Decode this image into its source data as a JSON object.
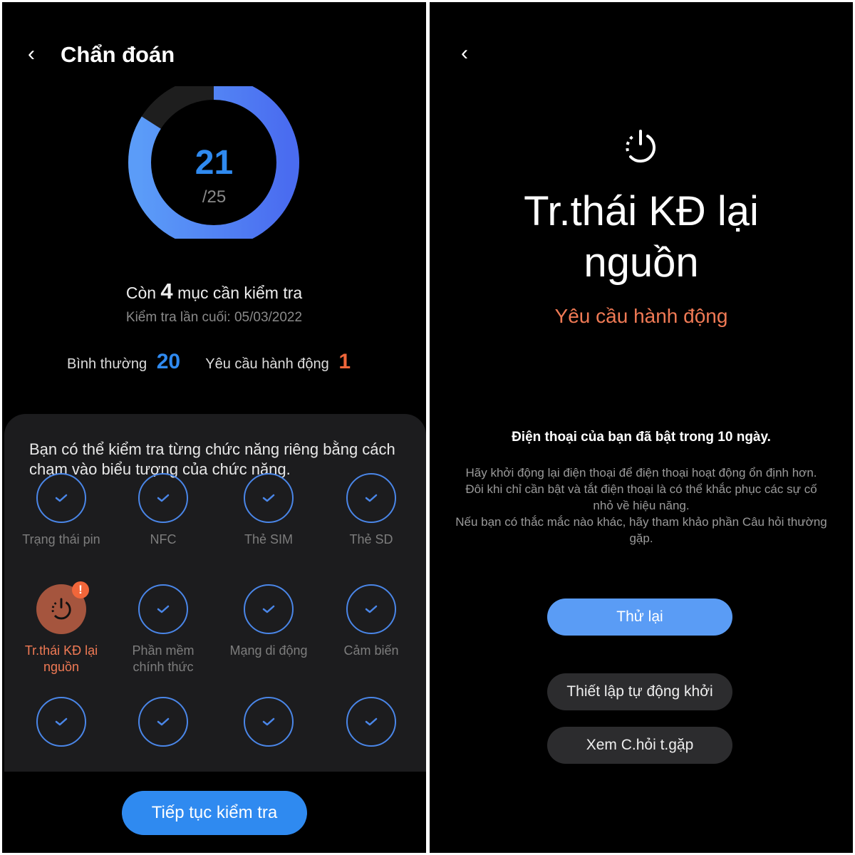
{
  "left": {
    "title": "Chẩn đoán",
    "ring": {
      "value": 21,
      "total_label": "/25",
      "value_label": "21",
      "fill_fraction": 0.84,
      "fill_color": "#4f86f7",
      "empty_color": "#1e1e1e"
    },
    "remaining": {
      "prefix": "Còn",
      "count": "4",
      "suffix": "mục cần kiểm tra"
    },
    "last_check": "Kiểm tra lần cuối: 05/03/2022",
    "stats": {
      "normal_label": "Bình thường",
      "normal_count": "20",
      "action_label": "Yêu cầu hành động",
      "action_count": "1"
    },
    "card_text": "Bạn có thể kiểm tra từng chức năng riêng bằng cách chạm vào biểu tượng của chức năng.",
    "items": [
      {
        "label": "Trạng thái pin",
        "status": "ok"
      },
      {
        "label": "NFC",
        "status": "ok"
      },
      {
        "label": "Thẻ SIM",
        "status": "ok"
      },
      {
        "label": "Thẻ SD",
        "status": "ok"
      },
      {
        "label": "Tr.thái KĐ lại nguồn",
        "status": "action"
      },
      {
        "label": "Phần mềm chính thức",
        "status": "ok"
      },
      {
        "label": "Mạng di động",
        "status": "ok"
      },
      {
        "label": "Cảm biến",
        "status": "ok"
      },
      {
        "label": "",
        "status": "ok"
      },
      {
        "label": "",
        "status": "ok"
      },
      {
        "label": "",
        "status": "ok"
      },
      {
        "label": "",
        "status": "ok"
      }
    ],
    "continue_button": "Tiếp tục kiểm tra"
  },
  "right": {
    "title_line1": "Tr.thái KĐ lại",
    "title_line2": "nguồn",
    "status": "Yêu cầu hành động",
    "headline": "Điện thoại của bạn đã bật trong 10 ngày.",
    "para1": "Hãy khởi động lại điện thoại để điện thoại hoạt động ổn định hơn.",
    "para2": "Đôi khi chỉ cần bật và tắt điện thoại là có thể khắc phục các sự cố nhỏ về hiệu năng.",
    "para3": "Nếu bạn có thắc mắc nào khác, hãy tham khảo phần Câu hỏi thường gặp.",
    "retry_button": "Thử lại",
    "auto_restart_button": "Thiết lập tự động khởi",
    "faq_button": "Xem C.hỏi t.gặp"
  },
  "colors": {
    "accent": "#3d8ef5",
    "warning": "#f0663a",
    "action_text": "#f07a55",
    "button_blue": "#5a9cf5"
  }
}
